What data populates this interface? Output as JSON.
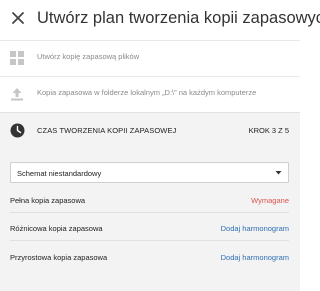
{
  "header": {
    "close_icon": "close-icon",
    "title": "Utwórz plan tworzenia kopii zapasowych"
  },
  "steps": [
    {
      "icon": "grid-icon",
      "label": "Utwórz kopię zapasową plików"
    },
    {
      "icon": "upload-icon",
      "label": "Kopia zapasowa w folderze lokalnym „D:\\” na każdym komputerze"
    }
  ],
  "schedule": {
    "icon": "clock-icon",
    "title": "CZAS TWORZENIA KOPII ZAPASOWEJ",
    "step_counter": "KROK 3 Z 5",
    "scheme_select": {
      "value": "Schemat niestandardowy"
    },
    "rows": [
      {
        "label": "Pełna kopia zapasowa",
        "action": "Wymagane"
      },
      {
        "label": "Różnicowa kopia zapasowa",
        "action": "Dodaj harmonogram"
      },
      {
        "label": "Przyrostowa kopia zapasowa",
        "action": "Dodaj harmonogram"
      }
    ]
  },
  "colors": {
    "required": "#d9534f",
    "link": "#2f6fb3",
    "section_bg": "#f3f3f3"
  }
}
